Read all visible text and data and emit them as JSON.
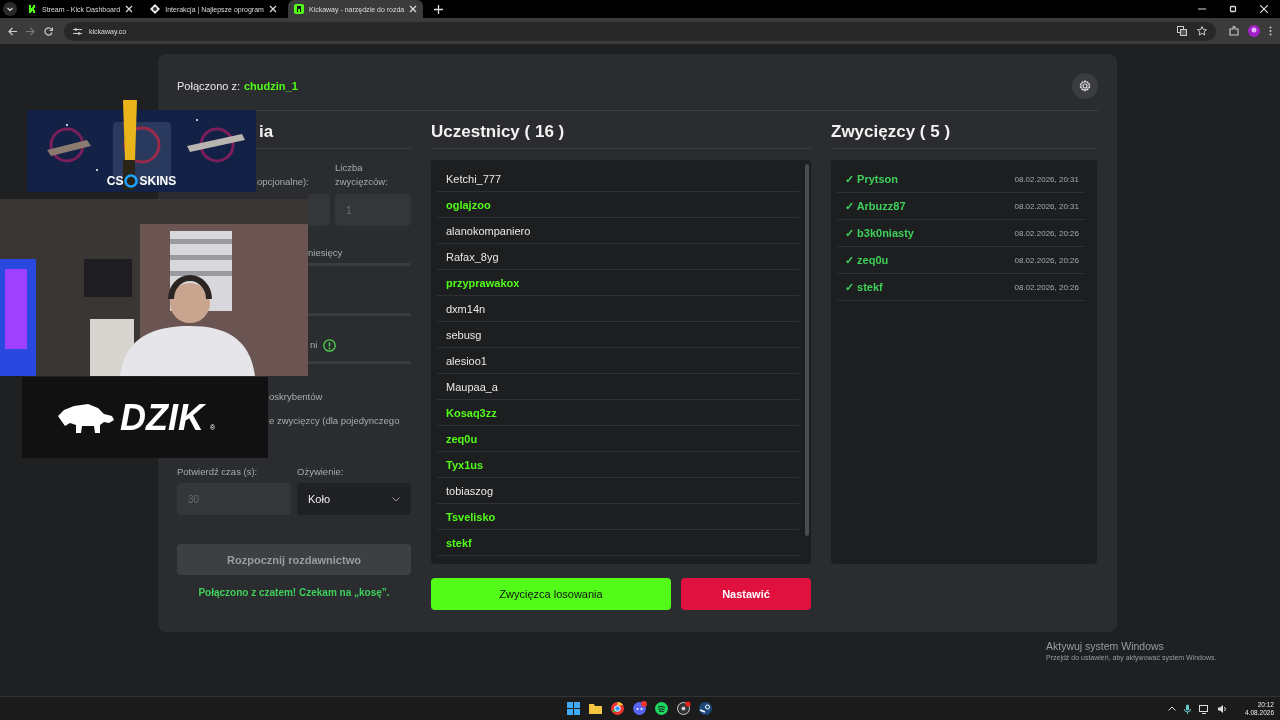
{
  "browser": {
    "tabs": [
      {
        "title": "Stream - Kick Dashboard",
        "selected": false
      },
      {
        "title": "Interakcja | Najlepsze oprogram",
        "selected": false
      },
      {
        "title": "Kickaway - narzędzie do rozda",
        "selected": true
      }
    ],
    "url": "kickaway.co"
  },
  "header": {
    "label": "Połączono z:",
    "user": "chudzin_1"
  },
  "settings": {
    "heading": "ia",
    "keyword_label": "opcjonalne):",
    "winners_label": "Liczba zwycięzców:",
    "winners_placeholder": "1",
    "months_label": "niesięcy",
    "days_label": "ni",
    "subs_label": "oskrybentów",
    "single_label": "e zwycięzcy (dla pojedynczego",
    "time_label": "Potwierdź czas (s):",
    "animation_label": "Ożywienie:",
    "time_placeholder": "30",
    "animation_value": "Koło",
    "start_button": {
      "label": "Rozpocznij rozdawnictwo",
      "disabled": true
    },
    "status": "Połączono z czatem! Czekam na „kosę”."
  },
  "participants": {
    "title": "Uczestnicy ( 16 )",
    "items": [
      {
        "name": "Ketchi_777",
        "active": false
      },
      {
        "name": "oglajzoo",
        "active": true
      },
      {
        "name": "alanokompaniero",
        "active": false
      },
      {
        "name": "Rafax_8yg",
        "active": false
      },
      {
        "name": "przyprawakox",
        "active": true
      },
      {
        "name": "dxm14n",
        "active": false
      },
      {
        "name": "sebusg",
        "active": false
      },
      {
        "name": "alesioo1",
        "active": false
      },
      {
        "name": "Maupaa_a",
        "active": false
      },
      {
        "name": "Kosaq3zz",
        "active": true
      },
      {
        "name": "zeq0u",
        "active": true
      },
      {
        "name": "Tyx1us",
        "active": true
      },
      {
        "name": "tobiaszog",
        "active": false
      },
      {
        "name": "Tsvelisko",
        "active": true
      },
      {
        "name": "stekf",
        "active": true
      }
    ]
  },
  "draw_button": "Zwycięzca losowania",
  "reset_button": "Nastawić",
  "winners": {
    "title": "Zwycięzcy ( 5 )",
    "items": [
      {
        "name": "✓ Prytson",
        "time": "08.02.2026, 20:31"
      },
      {
        "name": "✓ Arbuzz87",
        "time": "08.02.2026, 20:31"
      },
      {
        "name": "✓ b3k0niasty",
        "time": "08.02.2026, 20:26"
      },
      {
        "name": "✓ zeq0u",
        "time": "08.02.2026, 20:26"
      },
      {
        "name": "✓ stekf",
        "time": "08.02.2026, 20:26"
      }
    ]
  },
  "overlays": {
    "banner_left": "CS",
    "banner_right": "SKINS",
    "logo": "DZIK",
    "logo_mark": "®"
  },
  "windows_notice": {
    "title": "Aktywuj system Windows",
    "text": "Przejdź do ustawień, aby aktywować system Windows."
  },
  "taskbar": {
    "time": "20:12",
    "date": "4.08.2026"
  }
}
